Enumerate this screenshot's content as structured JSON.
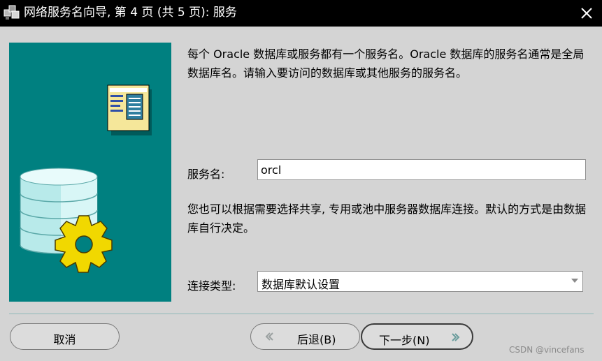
{
  "window": {
    "title": "网络服务名向导, 第 4 页 (共 5 页): 服务",
    "icon": "app-cubes-icon",
    "close_icon": "close-icon"
  },
  "main": {
    "intro_text": "每个 Oracle 数据库或服务都有一个服务名。Oracle 数据库的服务名通常是全局数据库名。请输入要访问的数据库或其他服务的服务名。",
    "service_name_label": "服务名:",
    "service_name_value": "orcl",
    "connection_text": "您也可以根据需要选择共享, 专用或池中服务器数据库连接。默认的方式是由数据库自行决定。",
    "connection_type_label": "连接类型:",
    "connection_type_value": "数据库默认设置"
  },
  "footer": {
    "cancel_label": "取消",
    "back_label": "后退(B)",
    "next_label": "下一步(N)"
  },
  "watermark": "CSDN @vincefans",
  "colors": {
    "panel_bg": "#008080",
    "dialog_bg": "#d4d4d4",
    "title_bar": "#000000"
  }
}
